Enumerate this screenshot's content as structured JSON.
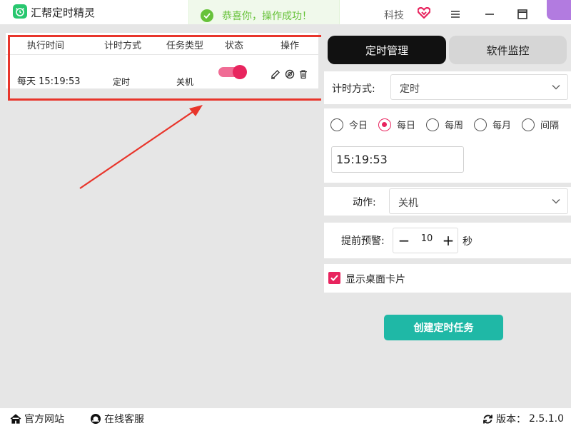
{
  "app": {
    "title": "汇帮定时精灵",
    "brand": "科技"
  },
  "toast": {
    "message": "恭喜你，操作成功！"
  },
  "table": {
    "headers": [
      "执行时间",
      "计时方式",
      "任务类型",
      "状态",
      "操作"
    ],
    "rows": [
      {
        "time": "每天 15:19:53",
        "mode": "定时",
        "type": "关机",
        "enabled": true
      }
    ]
  },
  "tabs": {
    "active": "定时管理",
    "inactive": "软件监控"
  },
  "form": {
    "timing_label": "计时方式:",
    "timing_value": "定时",
    "frequency_options": [
      "今日",
      "每日",
      "每周",
      "每月",
      "间隔"
    ],
    "frequency_selected": "每日",
    "time_value": "15:19:53",
    "action_label": "动作:",
    "action_value": "关机",
    "warning_label": "提前预警:",
    "warning_minus": "−",
    "warning_value": "10",
    "warning_plus": "+",
    "warning_unit": "秒",
    "show_card_label": "显示桌面卡片",
    "show_card_checked": true,
    "create_button": "创建定时任务"
  },
  "footer": {
    "website": "官方网站",
    "support": "在线客服",
    "version_label": "版本：",
    "version": "2.5.1.0"
  },
  "colors": {
    "accent": "#e8245e",
    "primary_button": "#1fb8a6",
    "success": "#67c23a",
    "highlight": "#e8352b"
  }
}
